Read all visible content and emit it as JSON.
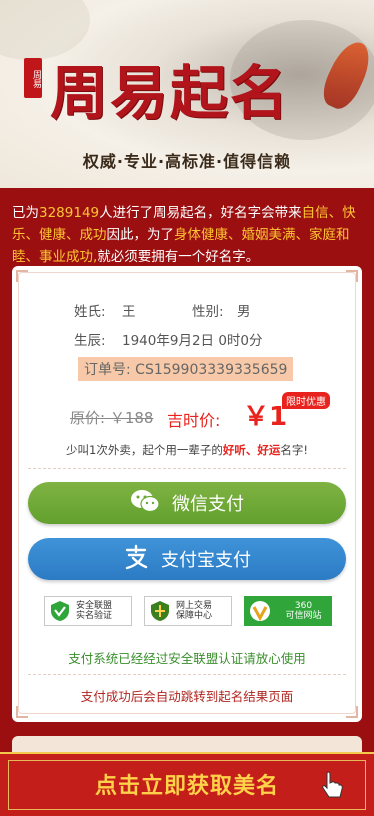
{
  "banner": {
    "seal": "周易",
    "title": "周易起名",
    "subtitle": "权威·专业·高标准·值得信赖"
  },
  "intro": {
    "p1": "已为",
    "count": "3289149",
    "p2": "人进行了周易起名，好名字会带来",
    "benefits1": "自信、快乐、健康、成功",
    "p3": "因此，为了",
    "benefits2": "身体健康、婚姻美满、家庭和睦、事业成功,",
    "p4": "就必须要拥有一个好名字。"
  },
  "order": {
    "name_label": "姓氏:",
    "name_value": "王",
    "gender_label": "性别:",
    "gender_value": "男",
    "birth_label": "生辰:",
    "birth_value": "1940年9月2日 0时0分",
    "order_text": "订单号: CS159903339335659",
    "old_price": "原价: ￥188",
    "price_label": "吉时价:",
    "price_value": "￥1",
    "badge": "限时优惠",
    "slogan_p1": "少叫1次外卖，起个用一辈子的",
    "slogan_hl": "好听、好运",
    "slogan_p2": "名字!"
  },
  "payment": {
    "wechat_label": "微信支付",
    "alipay_label": "支付宝支付",
    "cert1_l1": "安全联盟",
    "cert1_l2": "实名验证",
    "cert2_l1": "网上交易",
    "cert2_l2": "保障中心",
    "cert3_l1": "360",
    "cert3_l2": "可信网站",
    "secure_text": "支付系统已经经过安全联盟认证请放心使用",
    "redirect_text": "支付成功后会自动跳转到起名结果页面"
  },
  "cta": {
    "label": "点击立即获取美名"
  },
  "colors": {
    "background": "#9b0f10",
    "accent_red": "#e8231d",
    "highlight_yellow": "#ffc533",
    "wechat_green": "#6aa834",
    "alipay_blue": "#3388d0",
    "cta_gold": "#ffd24a"
  }
}
